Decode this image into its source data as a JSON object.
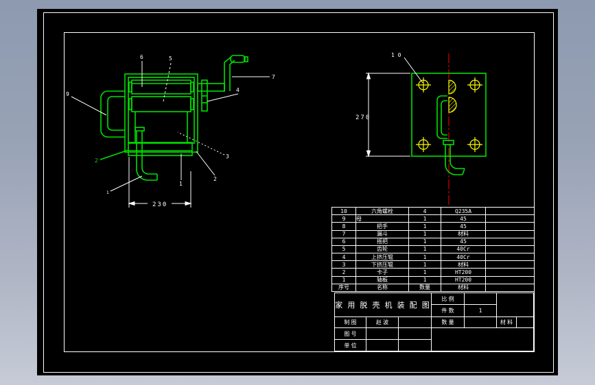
{
  "colors": {
    "drawing_green": "#00e000",
    "dimension_white": "#ffffff",
    "centerline_red": "#ff0000",
    "hole_yellow": "#ffff00",
    "canvas_black": "#000000"
  },
  "left_view": {
    "dim_width": "230",
    "callouts": {
      "n1": "1",
      "n1b": "1",
      "n2_green": "2",
      "n2": "2",
      "n3": "3",
      "n4": "4",
      "n5": "5",
      "n6": "6",
      "n7": "7",
      "n9": "9"
    }
  },
  "right_view": {
    "dim_height": "270",
    "callout_bolt": "1 0"
  },
  "parts_table": {
    "rows": [
      {
        "no": "10",
        "name": "六角螺栓",
        "qty": "4",
        "material": "Q235A",
        "note": ""
      },
      {
        "no": "9",
        "name": "母",
        "qty": "1",
        "material": "45",
        "note": ""
      },
      {
        "no": "8",
        "name": "把手",
        "qty": "1",
        "material": "45",
        "note": ""
      },
      {
        "no": "7",
        "name": "漏斗",
        "qty": "1",
        "material": "材料",
        "note": ""
      },
      {
        "no": "6",
        "name": "摇把",
        "qty": "1",
        "material": "45",
        "note": ""
      },
      {
        "no": "5",
        "name": "齿轮",
        "qty": "1",
        "material": "40Cr",
        "note": ""
      },
      {
        "no": "4",
        "name": "上挤压辊",
        "qty": "1",
        "material": "40Cr",
        "note": ""
      },
      {
        "no": "3",
        "name": "下挤压辊",
        "qty": "1",
        "material": "材料",
        "note": ""
      },
      {
        "no": "2",
        "name": "卡子",
        "qty": "1",
        "material": "HT200",
        "note": ""
      },
      {
        "no": "1",
        "name": "轴板",
        "qty": "1",
        "material": "HT200",
        "note": ""
      }
    ],
    "header": {
      "no": "序号",
      "name": "名称",
      "qty": "数量",
      "material": "材料",
      "note": ""
    }
  },
  "title_block": {
    "title": "家 用 脱 壳 机 装 配 图",
    "scale_label": "比 例",
    "scale_value": "",
    "pieces_label": "件 数",
    "pieces_value": "1",
    "qty_label": "数 量",
    "qty_value": "",
    "material_label": "材 料",
    "drawn_label": "制 图",
    "drawn_value": "赵 波",
    "drawing_no_label": "图 号",
    "unit_label": "单 位"
  }
}
